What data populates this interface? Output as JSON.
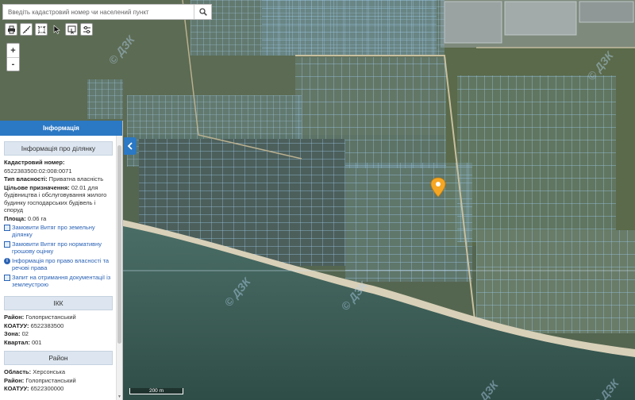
{
  "search": {
    "placeholder": "Введіть кадастровий номер чи населений пункт",
    "icon": "search-icon"
  },
  "toolbar": {
    "tools": [
      "print-icon",
      "measure-icon",
      "extent-icon",
      "pointer-icon",
      "identify-icon",
      "layers-icon"
    ]
  },
  "zoom": {
    "in_label": "+",
    "out_label": "-"
  },
  "panel": {
    "title": "Інформація",
    "parcel": {
      "heading": "Інформація про ділянку",
      "cadastral_label": "Кадастровий номер:",
      "cadastral_value": "6522383500:02:008:0071",
      "ownership_label": "Тип власності:",
      "ownership_value": "Приватна власність",
      "purpose_label": "Цільове призначення:",
      "purpose_value": "02.01 для будівництва і обслуговування жилого будинку господарських будівель і споруд",
      "area_label": "Площа:",
      "area_value": "0.06 га",
      "links": [
        {
          "label": "Замовити Витяг про земельну ділянку",
          "icon": "document-icon"
        },
        {
          "label": "Замовити Витяг про нормативну грошову оцінку",
          "icon": "document-icon"
        },
        {
          "label": "Інформація про право власності та речові права",
          "icon": "info-icon"
        },
        {
          "label": "Запит на отримання документації із землеустрою",
          "icon": "document-icon"
        }
      ]
    },
    "ikk": {
      "heading": "ІКК",
      "district_label": "Район:",
      "district_value": "Голопристанський",
      "koatuu_label": "КОАТУУ:",
      "koatuu_value": "6522383500",
      "zone_label": "Зона:",
      "zone_value": "02",
      "quarter_label": "Квартал:",
      "quarter_value": "001"
    },
    "district": {
      "heading": "Район",
      "oblast_label": "Область:",
      "oblast_value": "Херсонська",
      "district_label": "Район:",
      "district_value": "Голопристанський",
      "koatuu_label": "КОАТУУ:",
      "koatuu_value": "6522300000"
    }
  },
  "map": {
    "scale_label": "200 m",
    "watermark_text": "© ДЗК",
    "colors": {
      "sea": "#3e5f57",
      "land": "#4f5e48",
      "parcel_line": "#8fc3e8",
      "marker": "#f5a623"
    }
  }
}
